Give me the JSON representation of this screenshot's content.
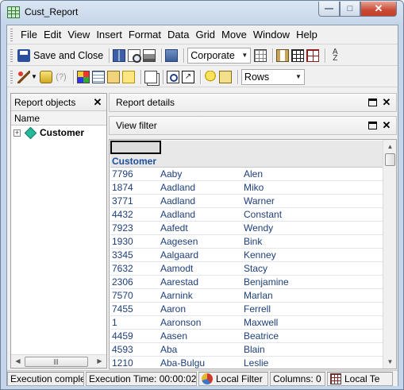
{
  "window": {
    "title": "Cust_Report"
  },
  "menu": [
    "File",
    "Edit",
    "View",
    "Insert",
    "Format",
    "Data",
    "Grid",
    "Move",
    "Window",
    "Help"
  ],
  "toolbar1": {
    "save_label": "Save and Close",
    "style_value": "Corporate"
  },
  "toolbar2": {
    "layout_value": "Rows"
  },
  "left_panel": {
    "title": "Report objects",
    "column_header": "Name",
    "tree": [
      {
        "label": "Customer",
        "expander": "+"
      }
    ]
  },
  "panels": {
    "details_title": "Report details",
    "filter_title": "View filter"
  },
  "grid": {
    "group_label": "Customer",
    "rows": [
      [
        "7796",
        "Aaby",
        "Alen"
      ],
      [
        "1874",
        "Aadland",
        "Miko"
      ],
      [
        "3771",
        "Aadland",
        "Warner"
      ],
      [
        "4432",
        "Aadland",
        "Constant"
      ],
      [
        "7923",
        "Aafedt",
        "Wendy"
      ],
      [
        "1930",
        "Aagesen",
        "Bink"
      ],
      [
        "3345",
        "Aalgaard",
        "Kenney"
      ],
      [
        "7632",
        "Aamodt",
        "Stacy"
      ],
      [
        "2306",
        "Aarestad",
        "Benjamine"
      ],
      [
        "7570",
        "Aarnink",
        "Marlan"
      ],
      [
        "7455",
        "Aaron",
        "Ferrell"
      ],
      [
        "1",
        "Aaronson",
        "Maxwell"
      ],
      [
        "4459",
        "Aasen",
        "Beatrice"
      ],
      [
        "4593",
        "Aba",
        "Blain"
      ],
      [
        "1210",
        "Aba-Bulgu",
        "Leslie"
      ]
    ]
  },
  "status": {
    "execution": "Execution comple",
    "time": "Execution Time: 00:00:02",
    "filter": "Local Filter",
    "columns": "Columns: 0",
    "local": "Local Te"
  }
}
